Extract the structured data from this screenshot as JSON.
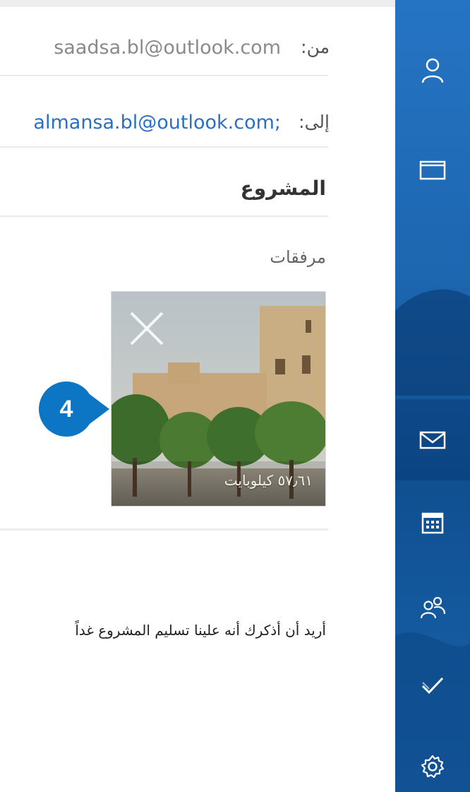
{
  "compose": {
    "from_label": "من:",
    "from_value": "saadsa.bl@outlook.com",
    "to_label": "إلى:",
    "to_value": "almansa.bl@outlook.com;",
    "subject": "المشروع",
    "attachments_label": "مرفقات",
    "attachment": {
      "size_text": "٥٧٫٦١ كيلوبايت"
    },
    "body_text": "أريد أن أذكرك أنه علينا تسليم المشروع غداً"
  },
  "callout": {
    "number": "4"
  },
  "sidebar": {
    "items": [
      {
        "name": "accounts",
        "icon": "person-icon"
      },
      {
        "name": "folders",
        "icon": "folder-icon"
      },
      {
        "name": "mail",
        "icon": "mail-icon",
        "active": true
      },
      {
        "name": "calendar",
        "icon": "calendar-icon"
      },
      {
        "name": "people",
        "icon": "people-icon"
      },
      {
        "name": "todo",
        "icon": "checkmark-icon"
      },
      {
        "name": "settings",
        "icon": "gear-icon"
      }
    ]
  },
  "colors": {
    "accent": "#1f6bb6",
    "link": "#2a6fc7",
    "callout": "#0d76c4"
  }
}
